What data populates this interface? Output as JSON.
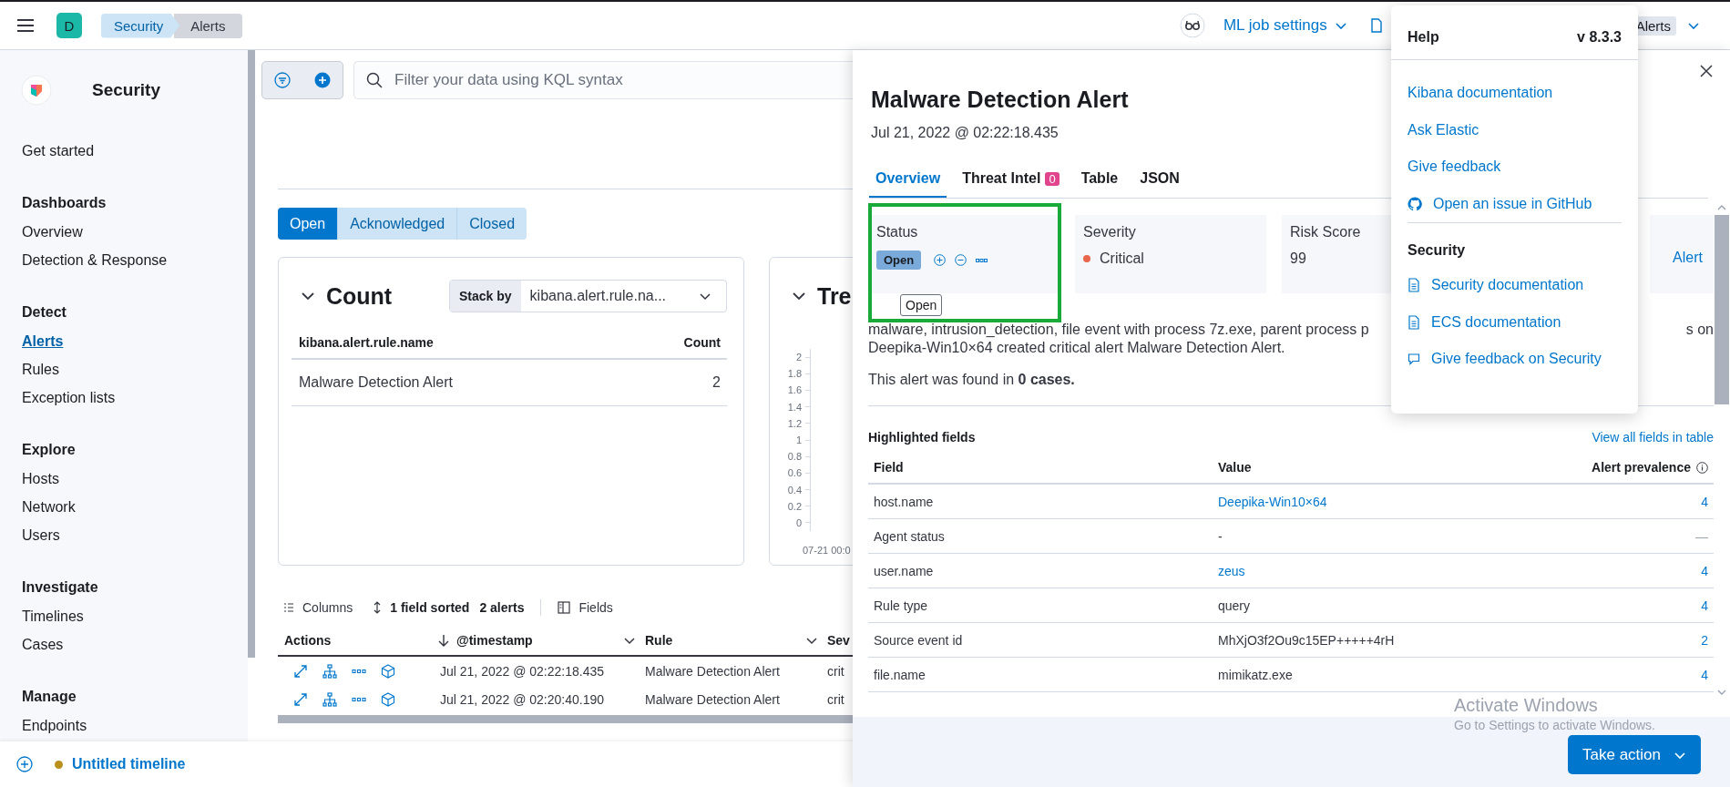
{
  "topbar": {
    "initial": "D",
    "breadcrumbs": [
      {
        "label": "Security",
        "current": false
      },
      {
        "label": "Alerts",
        "current": true
      }
    ],
    "ml_job_settings": "ML job settings",
    "alerts_badge": "Alerts"
  },
  "sidebar": {
    "title": "Security",
    "sections": [
      {
        "items": [
          {
            "label": "Get started",
            "selected": false
          }
        ]
      },
      {
        "heading": "Dashboards",
        "items": [
          {
            "label": "Overview",
            "selected": false
          },
          {
            "label": "Detection & Response",
            "selected": false
          }
        ]
      },
      {
        "heading": "Detect",
        "items": [
          {
            "label": "Alerts",
            "selected": true
          },
          {
            "label": "Rules",
            "selected": false
          },
          {
            "label": "Exception lists",
            "selected": false
          }
        ]
      },
      {
        "heading": "Explore",
        "items": [
          {
            "label": "Hosts",
            "selected": false
          },
          {
            "label": "Network",
            "selected": false
          },
          {
            "label": "Users",
            "selected": false
          }
        ]
      },
      {
        "heading": "Investigate",
        "items": [
          {
            "label": "Timelines",
            "selected": false
          },
          {
            "label": "Cases",
            "selected": false
          }
        ]
      },
      {
        "heading": "Manage",
        "items": [
          {
            "label": "Endpoints",
            "selected": false
          }
        ]
      }
    ]
  },
  "filter_bar": {
    "placeholder": "Filter your data using KQL syntax"
  },
  "status_tabs": [
    {
      "label": "Open",
      "selected": true
    },
    {
      "label": "Acknowledged",
      "selected": false
    },
    {
      "label": "Closed",
      "selected": false
    }
  ],
  "count_panel": {
    "title": "Count",
    "stack_by_label": "Stack by",
    "stack_by_value": "kibana.alert.rule.na...",
    "columns": [
      "kibana.alert.rule.name",
      "Count"
    ],
    "rows": [
      [
        "Malware Detection Alert",
        "2"
      ]
    ]
  },
  "trend_panel": {
    "title": "Tre",
    "y_ticks": [
      "2",
      "1.8",
      "1.6",
      "1.4",
      "1.2",
      "1",
      "0.8",
      "0.6",
      "0.4",
      "0.2",
      "0"
    ],
    "x_label": "07-21 00:0"
  },
  "table_toolbar": {
    "columns": "Columns",
    "sorted": "1 field sorted",
    "count": "2 alerts",
    "fields": "Fields"
  },
  "alerts_table": {
    "columns": [
      {
        "label": "Actions",
        "sorted": false,
        "menu": false
      },
      {
        "label": "@timestamp",
        "sorted": true,
        "menu": true
      },
      {
        "label": "Rule",
        "sorted": false,
        "menu": true
      },
      {
        "label": "Sev"
      }
    ],
    "rows": [
      {
        "timestamp": "Jul 21, 2022 @ 02:22:18.435",
        "rule": "Malware Detection Alert",
        "severity": "crit"
      },
      {
        "timestamp": "Jul 21, 2022 @ 02:20:40.190",
        "rule": "Malware Detection Alert",
        "severity": "crit"
      }
    ]
  },
  "timeline_bar": {
    "title": "Untitled timeline"
  },
  "flyout": {
    "title": "Malware Detection Alert",
    "timestamp": "Jul 21, 2022 @ 02:22:18.435",
    "tabs": [
      {
        "label": "Overview",
        "selected": true
      },
      {
        "label": "Threat Intel",
        "selected": false,
        "badge": "0"
      },
      {
        "label": "Table",
        "selected": false
      },
      {
        "label": "JSON",
        "selected": false
      }
    ],
    "cards": [
      {
        "kind": "status",
        "label": "Status",
        "value": "Open"
      },
      {
        "kind": "severity",
        "label": "Severity",
        "value": "Critical"
      },
      {
        "kind": "text",
        "label": "Risk Score",
        "value": "99"
      },
      {
        "kind": "link",
        "value": "Alert"
      }
    ],
    "status_tooltip": "Open",
    "description_line_1": [
      "malware, intrusion_detection, file event with process 7z.exe, parent process p",
      "s on"
    ],
    "description_line_2": "Deepika-Win10×64 created critical alert Malware Detection Alert.",
    "cases_text": "This alert was found in **0 cases.**",
    "highlighted_title": "Highlighted fields",
    "view_all": "View all fields in table",
    "field_columns": [
      "Field",
      "Value",
      "Alert prevalence"
    ],
    "fields": [
      {
        "field": "host.name",
        "value": "Deepika-Win10×64",
        "value_link": true,
        "prevalence": "4",
        "prevalence_link": true
      },
      {
        "field": "Agent status",
        "value": "-",
        "value_link": false,
        "prevalence": "—",
        "prevalence_link": false
      },
      {
        "field": "user.name",
        "value": "zeus",
        "value_link": true,
        "prevalence": "4",
        "prevalence_link": true
      },
      {
        "field": "Rule type",
        "value": "query",
        "value_link": false,
        "prevalence": "4",
        "prevalence_link": true
      },
      {
        "field": "Source event id",
        "value": "MhXjO3f2Ou9c15EP+++++4rH",
        "value_link": false,
        "prevalence": "2",
        "prevalence_link": true
      },
      {
        "field": "file.name",
        "value": "mimikatz.exe",
        "value_link": false,
        "prevalence": "4",
        "prevalence_link": true
      }
    ],
    "take_action": "Take action"
  },
  "help_menu": {
    "title": "Help",
    "version": "v 8.3.3",
    "links": [
      {
        "label": "Kibana documentation"
      },
      {
        "label": "Ask Elastic"
      },
      {
        "label": "Give feedback"
      },
      {
        "label": "Open an issue in GitHub"
      }
    ],
    "section": "Security",
    "section_links": [
      {
        "label": "Security documentation"
      },
      {
        "label": "ECS documentation"
      },
      {
        "label": "Give feedback on Security"
      }
    ]
  },
  "os_notice": {
    "title": "Activate Windows",
    "subtitle": "Go to Settings to activate Windows."
  }
}
